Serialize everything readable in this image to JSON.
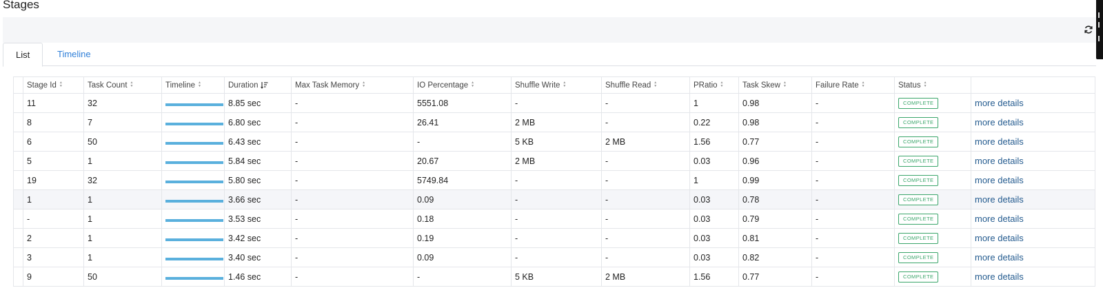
{
  "page": {
    "title": "Stages"
  },
  "tabs": [
    {
      "label": "List",
      "active": true
    },
    {
      "label": "Timeline",
      "active": false
    }
  ],
  "colors": {
    "tab_link": "#2f7fd8",
    "timeline_bar": "#5ab0dd",
    "status_complete": "#3aa56a",
    "details_link": "#245b8f"
  },
  "icons": {
    "refresh": "refresh-icon",
    "sort": "sort-icon",
    "sort_desc": "sort-desc-icon"
  },
  "table": {
    "columns": [
      {
        "label": "Stage Id",
        "sort": "both"
      },
      {
        "label": "Task Count",
        "sort": "both"
      },
      {
        "label": "Timeline",
        "sort": "both"
      },
      {
        "label": "Duration",
        "sort": "desc"
      },
      {
        "label": "Max Task Memory",
        "sort": "both"
      },
      {
        "label": "IO Percentage",
        "sort": "both"
      },
      {
        "label": "Shuffle Write",
        "sort": "both"
      },
      {
        "label": "Shuffle Read",
        "sort": "both"
      },
      {
        "label": "PRatio",
        "sort": "both"
      },
      {
        "label": "Task Skew",
        "sort": "both"
      },
      {
        "label": "Failure Rate",
        "sort": "both"
      },
      {
        "label": "Status",
        "sort": "both"
      },
      {
        "label": "",
        "sort": "none"
      }
    ],
    "rows": [
      {
        "stage_id": "11",
        "task_count": "32",
        "duration": "8.85 sec",
        "max_task_memory": "-",
        "io_percentage": "5551.08",
        "shuffle_write": "-",
        "shuffle_read": "-",
        "pratio": "1",
        "task_skew": "0.98",
        "failure_rate": "-",
        "status": "COMPLETE",
        "details": "more details",
        "highlight": false
      },
      {
        "stage_id": "8",
        "task_count": "7",
        "duration": "6.80 sec",
        "max_task_memory": "-",
        "io_percentage": "26.41",
        "shuffle_write": "2 MB",
        "shuffle_read": "-",
        "pratio": "0.22",
        "task_skew": "0.98",
        "failure_rate": "-",
        "status": "COMPLETE",
        "details": "more details",
        "highlight": false
      },
      {
        "stage_id": "6",
        "task_count": "50",
        "duration": "6.43 sec",
        "max_task_memory": "-",
        "io_percentage": "-",
        "shuffle_write": "5 KB",
        "shuffle_read": "2 MB",
        "pratio": "1.56",
        "task_skew": "0.77",
        "failure_rate": "-",
        "status": "COMPLETE",
        "details": "more details",
        "highlight": false
      },
      {
        "stage_id": "5",
        "task_count": "1",
        "duration": "5.84 sec",
        "max_task_memory": "-",
        "io_percentage": "20.67",
        "shuffle_write": "2 MB",
        "shuffle_read": "-",
        "pratio": "0.03",
        "task_skew": "0.96",
        "failure_rate": "-",
        "status": "COMPLETE",
        "details": "more details",
        "highlight": false
      },
      {
        "stage_id": "19",
        "task_count": "32",
        "duration": "5.80 sec",
        "max_task_memory": "-",
        "io_percentage": "5749.84",
        "shuffle_write": "-",
        "shuffle_read": "-",
        "pratio": "1",
        "task_skew": "0.99",
        "failure_rate": "-",
        "status": "COMPLETE",
        "details": "more details",
        "highlight": false
      },
      {
        "stage_id": "1",
        "task_count": "1",
        "duration": "3.66 sec",
        "max_task_memory": "-",
        "io_percentage": "0.09",
        "shuffle_write": "-",
        "shuffle_read": "-",
        "pratio": "0.03",
        "task_skew": "0.78",
        "failure_rate": "-",
        "status": "COMPLETE",
        "details": "more details",
        "highlight": true
      },
      {
        "stage_id": "-",
        "task_count": "1",
        "duration": "3.53 sec",
        "max_task_memory": "-",
        "io_percentage": "0.18",
        "shuffle_write": "-",
        "shuffle_read": "-",
        "pratio": "0.03",
        "task_skew": "0.79",
        "failure_rate": "-",
        "status": "COMPLETE",
        "details": "more details",
        "highlight": false
      },
      {
        "stage_id": "2",
        "task_count": "1",
        "duration": "3.42 sec",
        "max_task_memory": "-",
        "io_percentage": "0.19",
        "shuffle_write": "-",
        "shuffle_read": "-",
        "pratio": "0.03",
        "task_skew": "0.81",
        "failure_rate": "-",
        "status": "COMPLETE",
        "details": "more details",
        "highlight": false
      },
      {
        "stage_id": "3",
        "task_count": "1",
        "duration": "3.40 sec",
        "max_task_memory": "-",
        "io_percentage": "0.09",
        "shuffle_write": "-",
        "shuffle_read": "-",
        "pratio": "0.03",
        "task_skew": "0.82",
        "failure_rate": "-",
        "status": "COMPLETE",
        "details": "more details",
        "highlight": false
      },
      {
        "stage_id": "9",
        "task_count": "50",
        "duration": "1.46 sec",
        "max_task_memory": "-",
        "io_percentage": "-",
        "shuffle_write": "5 KB",
        "shuffle_read": "2 MB",
        "pratio": "1.56",
        "task_skew": "0.77",
        "failure_rate": "-",
        "status": "COMPLETE",
        "details": "more details",
        "highlight": false
      }
    ]
  }
}
